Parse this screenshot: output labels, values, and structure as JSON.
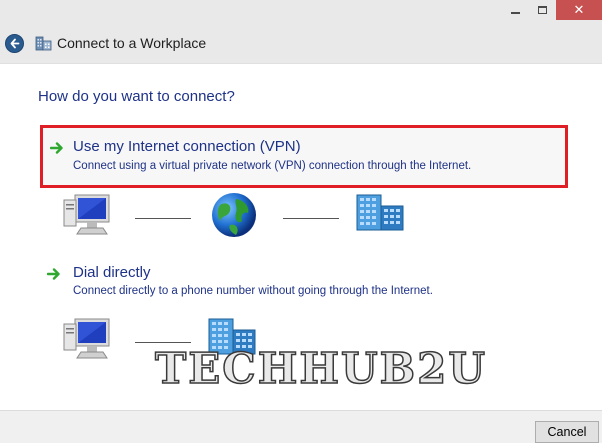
{
  "window": {
    "title": "Connect to a Workplace",
    "controls": [
      "minimize",
      "maximize",
      "close"
    ]
  },
  "prompt": "How do you want to connect?",
  "options": [
    {
      "title": "Use my Internet connection (VPN)",
      "description": "Connect using a virtual private network (VPN) connection through the Internet.",
      "highlighted": true,
      "diagram": [
        "computer-icon",
        "globe-icon",
        "office-building-icon"
      ]
    },
    {
      "title": "Dial directly",
      "description": "Connect directly to a phone number without going through the Internet.",
      "highlighted": false,
      "diagram": [
        "computer-icon",
        "office-building-icon"
      ]
    }
  ],
  "watermark": "TECHHUB2U",
  "footer": {
    "cancel_label": "Cancel"
  },
  "colors": {
    "link_blue": "#1e3287",
    "highlight_border": "#e01e25",
    "titlebar": "#e9e9e9",
    "close_button": "#c75050",
    "arrow_green": "#2fa82f"
  }
}
